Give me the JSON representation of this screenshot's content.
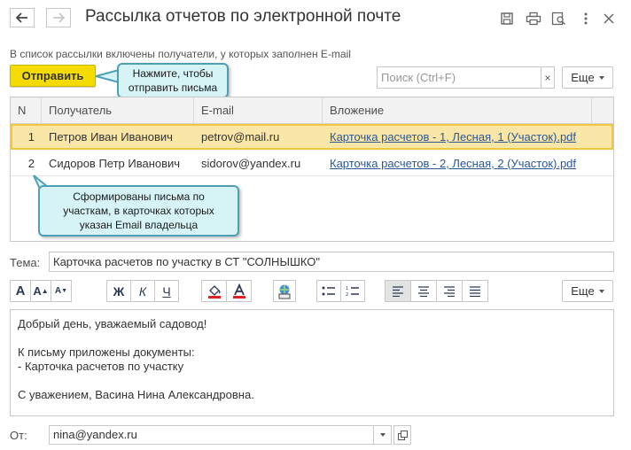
{
  "window": {
    "title": "Рассылка отчетов по электронной почте"
  },
  "hint_text": "В список рассылки включены получатели, у которых заполнен E-mail",
  "toolbar": {
    "send_label": "Отправить",
    "search_placeholder": "Поиск (Ctrl+F)",
    "search_clear": "×",
    "more_label": "Еще"
  },
  "callouts": {
    "send_hint_line1": "Нажмите, чтобы",
    "send_hint_line2": "отправить письма",
    "table_hint_line1": "Сформированы письма по",
    "table_hint_line2": "участкам, в карточках которых",
    "table_hint_line3": "указан Email владельца"
  },
  "table": {
    "columns": [
      "N",
      "Получатель",
      "E-mail",
      "Вложение"
    ],
    "rows": [
      {
        "n": "1",
        "recipient": "Петров Иван Иванович",
        "email": "petrov@mail.ru",
        "attachment": "Карточка расчетов - 1, Лесная, 1 (Участок).pdf"
      },
      {
        "n": "2",
        "recipient": "Сидоров Петр Иванович",
        "email": "sidorov@yandex.ru",
        "attachment": "Карточка расчетов - 2, Лесная, 2 (Участок).pdf"
      }
    ]
  },
  "subject": {
    "label": "Тема:",
    "value": "Карточка расчетов по участку в СТ \"СОЛНЫШКО\""
  },
  "format_toolbar": {
    "bold_label": "Ж",
    "italic_label": "К",
    "underline_label": "Ч",
    "font_letter": "A",
    "more_label": "Еще"
  },
  "message": {
    "lines": [
      "Добрый день, уважаемый садовод!",
      "",
      "К письму приложены документы:",
      "- Карточка расчетов по участку",
      "",
      "С уважением, Васина Нина Александровна."
    ]
  },
  "from": {
    "label": "От:",
    "value": "nina@yandex.ru"
  },
  "colors": {
    "accent_yellow": "#f5dc00",
    "selected_row": "#fae6a6",
    "callout_bg": "#d6f3f6",
    "callout_border": "#4e9fb4",
    "link": "#2b5797"
  }
}
